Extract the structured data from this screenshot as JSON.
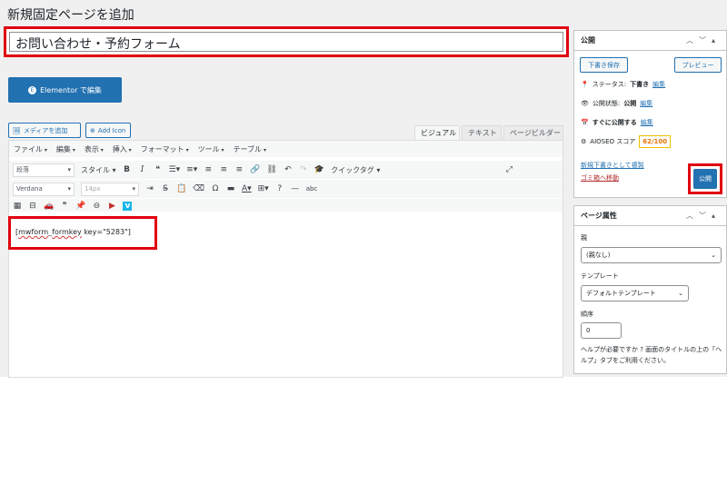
{
  "page": {
    "heading": "新規固定ページを追加"
  },
  "title": {
    "value": "お問い合わせ・予約フォーム"
  },
  "elementor": {
    "label": "Elementor で編集"
  },
  "media": {
    "add_media": "メディアを追加",
    "add_icon": "Add Icon"
  },
  "editor_tabs": [
    "ビジュアル",
    "テキスト",
    "ページビルダー"
  ],
  "menubar": [
    "ファイル",
    "編集",
    "表示",
    "挿入",
    "フォーマット",
    "ツール",
    "テーブル"
  ],
  "toolbar": {
    "format_select": "段落",
    "style_menu": "スタイル",
    "quicktag": "クイックタグ",
    "font_family": "Verdana",
    "font_size": "14px"
  },
  "content": {
    "shortcode_pre": "[",
    "shortcode_a": "mwform",
    "shortcode_sep": "_",
    "shortcode_b": "formkey",
    "shortcode_post": " key=\"5283\"]"
  },
  "publish_box": {
    "title": "公開",
    "save_draft": "下書き保存",
    "preview": "プレビュー",
    "status_label": "ステータス:",
    "status_value": "下書き",
    "status_edit": "編集",
    "visibility_label": "公開状態:",
    "visibility_value": "公開",
    "visibility_edit": "編集",
    "schedule_label": "すぐに公開する",
    "schedule_edit": "編集",
    "aioseo_label": "AIOSEO スコア",
    "aioseo_score": "62/100",
    "copy_draft": "新規下書きとして複製",
    "trash": "ゴミ箱へ移動",
    "publish": "公開"
  },
  "attributes_box": {
    "title": "ページ属性",
    "parent_label": "親",
    "parent_value": "(親なし)",
    "template_label": "テンプレート",
    "template_value": "デフォルトテンプレート",
    "order_label": "順序",
    "order_value": "0",
    "help": "ヘルプが必要ですか ? 画面のタイトルの上の「ヘルプ」タブをご利用ください。"
  },
  "colors": {
    "accent": "#2271b1",
    "highlight": "#e0000f",
    "score": "#e37400"
  }
}
